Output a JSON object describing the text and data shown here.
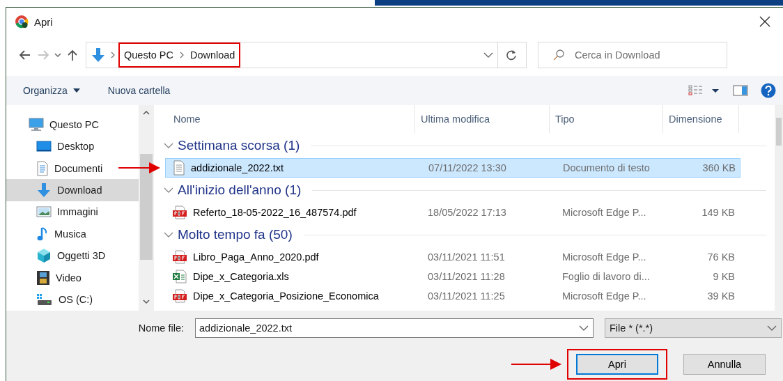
{
  "window": {
    "title": "Apri"
  },
  "nav": {
    "breadcrumb": [
      "Questo PC",
      "Download"
    ],
    "highlighted": true,
    "search_placeholder": "Cerca in Download"
  },
  "toolbar": {
    "organize": "Organizza",
    "new_folder": "Nuova cartella"
  },
  "sidebar": {
    "items": [
      {
        "label": "Questo PC",
        "kind": "pc",
        "selected": false,
        "children": [
          {
            "label": "Desktop",
            "kind": "desktop",
            "selected": false
          },
          {
            "label": "Documenti",
            "kind": "documents",
            "selected": false
          },
          {
            "label": "Download",
            "kind": "downloads",
            "selected": true
          },
          {
            "label": "Immagini",
            "kind": "pictures",
            "selected": false
          },
          {
            "label": "Musica",
            "kind": "music",
            "selected": false
          },
          {
            "label": "Oggetti 3D",
            "kind": "objects",
            "selected": false
          },
          {
            "label": "Video",
            "kind": "video",
            "selected": false
          },
          {
            "label": "OS (C:)",
            "kind": "drive",
            "selected": false
          }
        ]
      }
    ]
  },
  "columns": [
    "Nome",
    "Ultima modifica",
    "Tipo",
    "Dimensione"
  ],
  "groups": [
    {
      "title": "Settimana scorsa (1)",
      "expanded": true,
      "files": [
        {
          "name": "addizionale_2022.txt",
          "kind": "txt",
          "modified": "07/11/2022 13:30",
          "type": "Documento di testo",
          "size": "360 KB",
          "selected": true,
          "arrow": true
        }
      ]
    },
    {
      "title": "All'inizio dell'anno (1)",
      "expanded": true,
      "files": [
        {
          "name": "Referto_18-05-2022_16_487574.pdf",
          "kind": "pdf",
          "modified": "18/05/2022 17:13",
          "type": "Microsoft Edge P...",
          "size": "149 KB",
          "selected": false,
          "arrow": false
        }
      ]
    },
    {
      "title": "Molto tempo fa (50)",
      "expanded": true,
      "files": [
        {
          "name": "Libro_Paga_Anno_2020.pdf",
          "kind": "pdf",
          "modified": "03/11/2021 11:51",
          "type": "Microsoft Edge P...",
          "size": "76 KB",
          "selected": false,
          "arrow": false
        },
        {
          "name": "Dipe_x_Categoria.xls",
          "kind": "xls",
          "modified": "03/11/2021 11:28",
          "type": "Foglio di lavoro di...",
          "size": "9 KB",
          "selected": false,
          "arrow": false
        },
        {
          "name": "Dipe_x_Categoria_Posizione_Economica",
          "kind": "pdf",
          "modified": "03/11/2021 11:25",
          "type": "Microsoft Edge P...",
          "size": "39 KB",
          "selected": false,
          "arrow": false
        }
      ]
    }
  ],
  "footer": {
    "filename_label": "Nome file:",
    "filename": "addizionale_2022.txt",
    "filter": "File * (*.*)",
    "buttons": [
      {
        "label": "Apri",
        "kind": "primary",
        "highlighted": true,
        "arrow": true
      },
      {
        "label": "Annulla",
        "kind": "secondary",
        "highlighted": false,
        "arrow": false
      }
    ]
  }
}
